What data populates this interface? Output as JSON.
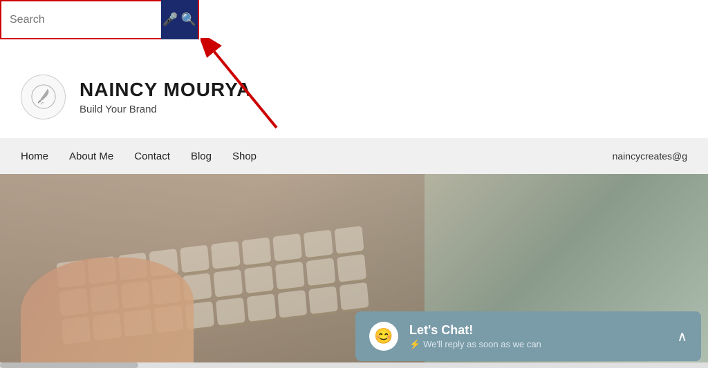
{
  "search": {
    "placeholder": "Search",
    "input_value": ""
  },
  "brand": {
    "name": "NAINCY MOURYA",
    "tagline": "Build Your Brand"
  },
  "nav": {
    "items": [
      {
        "label": "Home",
        "id": "home"
      },
      {
        "label": "About Me",
        "id": "about"
      },
      {
        "label": "Contact",
        "id": "contact"
      },
      {
        "label": "Blog",
        "id": "blog"
      },
      {
        "label": "Shop",
        "id": "shop"
      }
    ],
    "email_partial": "naincycreates@g"
  },
  "chat_widget": {
    "title": "Let's Chat!",
    "subtitle": "We'll reply as soon as we can",
    "avatar_emoji": "😊"
  },
  "colors": {
    "nav_bg": "#1a2a6c",
    "accent_red": "#cc0000",
    "chat_bg": "#7a9ba8"
  }
}
